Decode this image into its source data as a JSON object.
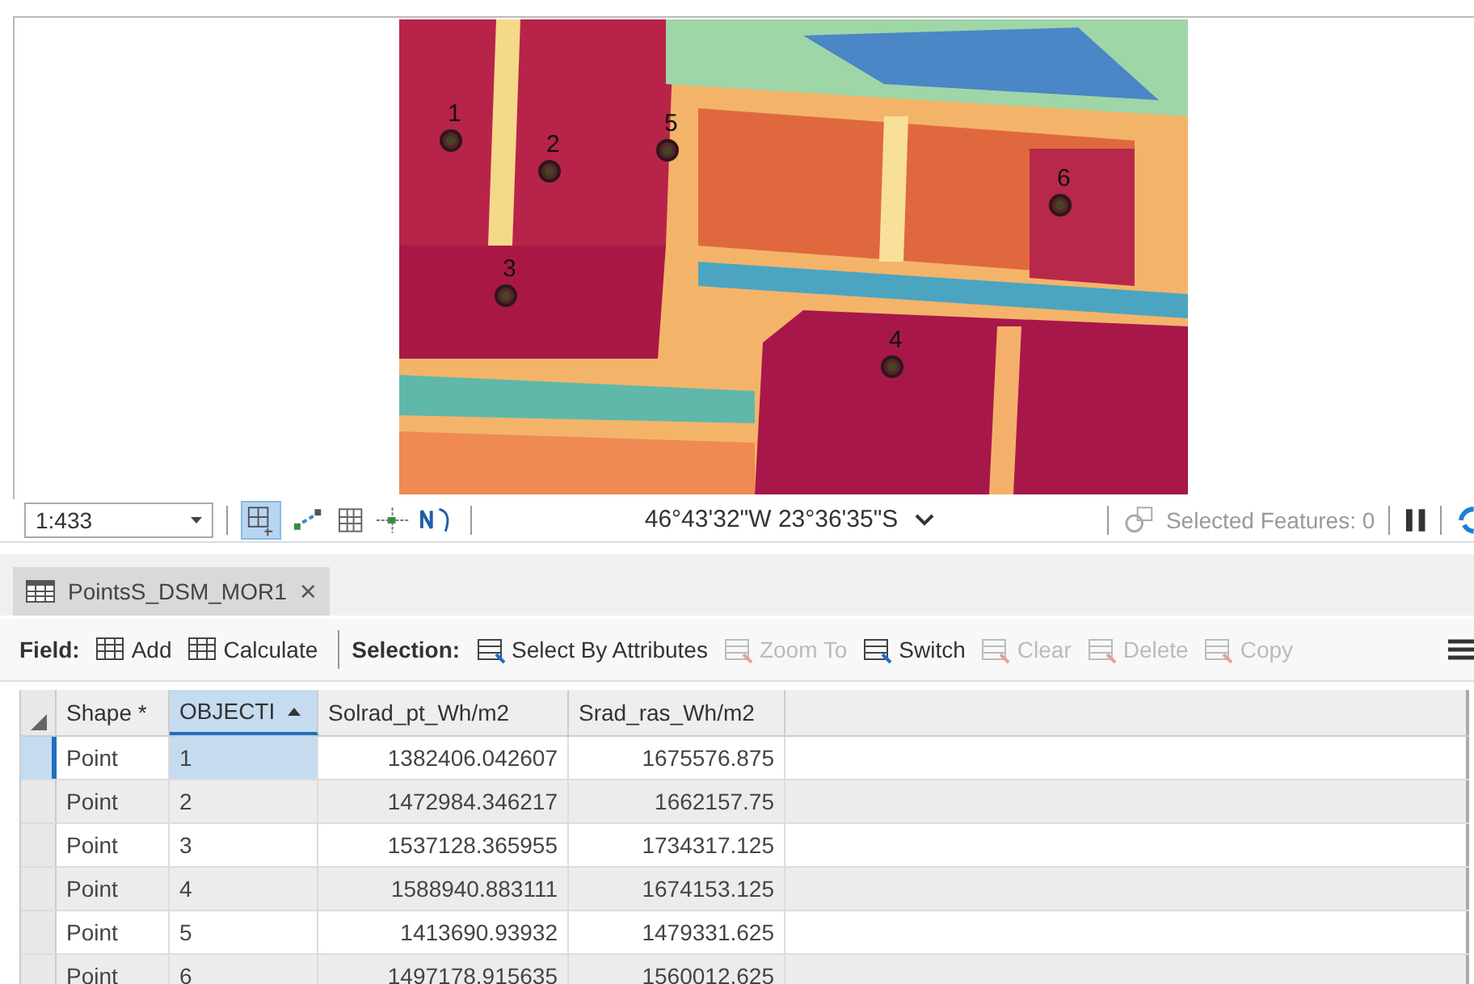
{
  "map": {
    "points": [
      {
        "label": "1"
      },
      {
        "label": "2"
      },
      {
        "label": "3"
      },
      {
        "label": "4"
      },
      {
        "label": "5"
      },
      {
        "label": "6"
      }
    ]
  },
  "status_bar": {
    "scale": "1:433",
    "coordinates": "46°43'32\"W 23°36'35\"S",
    "selected_features": "Selected Features: 0"
  },
  "tabs": [
    {
      "label": "PointsS_DSM_MOR1",
      "selected": true,
      "close": "×"
    }
  ],
  "toolbar": {
    "field_label": "Field:",
    "field_buttons": [
      {
        "label": "Add",
        "disabled": false
      },
      {
        "label": "Calculate",
        "disabled": false
      }
    ],
    "selection_label": "Selection:",
    "selection_buttons": [
      {
        "label": "Select By Attributes",
        "disabled": false
      },
      {
        "label": "Zoom To",
        "disabled": true
      },
      {
        "label": "Switch",
        "disabled": false
      },
      {
        "label": "Clear",
        "disabled": true
      },
      {
        "label": "Delete",
        "disabled": true
      },
      {
        "label": "Copy",
        "disabled": true
      }
    ]
  },
  "table": {
    "columns": [
      {
        "label": "Shape *",
        "selected": false,
        "kind": "text"
      },
      {
        "label": "OBJECTI",
        "selected": true,
        "kind": "text"
      },
      {
        "label": "Solrad_pt_Wh/m2",
        "selected": false,
        "kind": "number"
      },
      {
        "label": "Srad_ras_Wh/m2",
        "selected": false,
        "kind": "number"
      }
    ],
    "rows": [
      {
        "selected": true,
        "cells": [
          "Point",
          "1",
          "1382406.042607",
          "1675576.875"
        ]
      },
      {
        "selected": false,
        "cells": [
          "Point",
          "2",
          "1472984.346217",
          "1662157.75"
        ]
      },
      {
        "selected": false,
        "cells": [
          "Point",
          "3",
          "1537128.365955",
          "1734317.125"
        ]
      },
      {
        "selected": false,
        "cells": [
          "Point",
          "4",
          "1588940.883111",
          "1674153.125"
        ]
      },
      {
        "selected": false,
        "cells": [
          "Point",
          "5",
          "1413690.93932",
          "1479331.625"
        ]
      },
      {
        "selected": false,
        "cells": [
          "Point",
          "6",
          "1497178.915635",
          "1560012.625"
        ]
      }
    ]
  }
}
